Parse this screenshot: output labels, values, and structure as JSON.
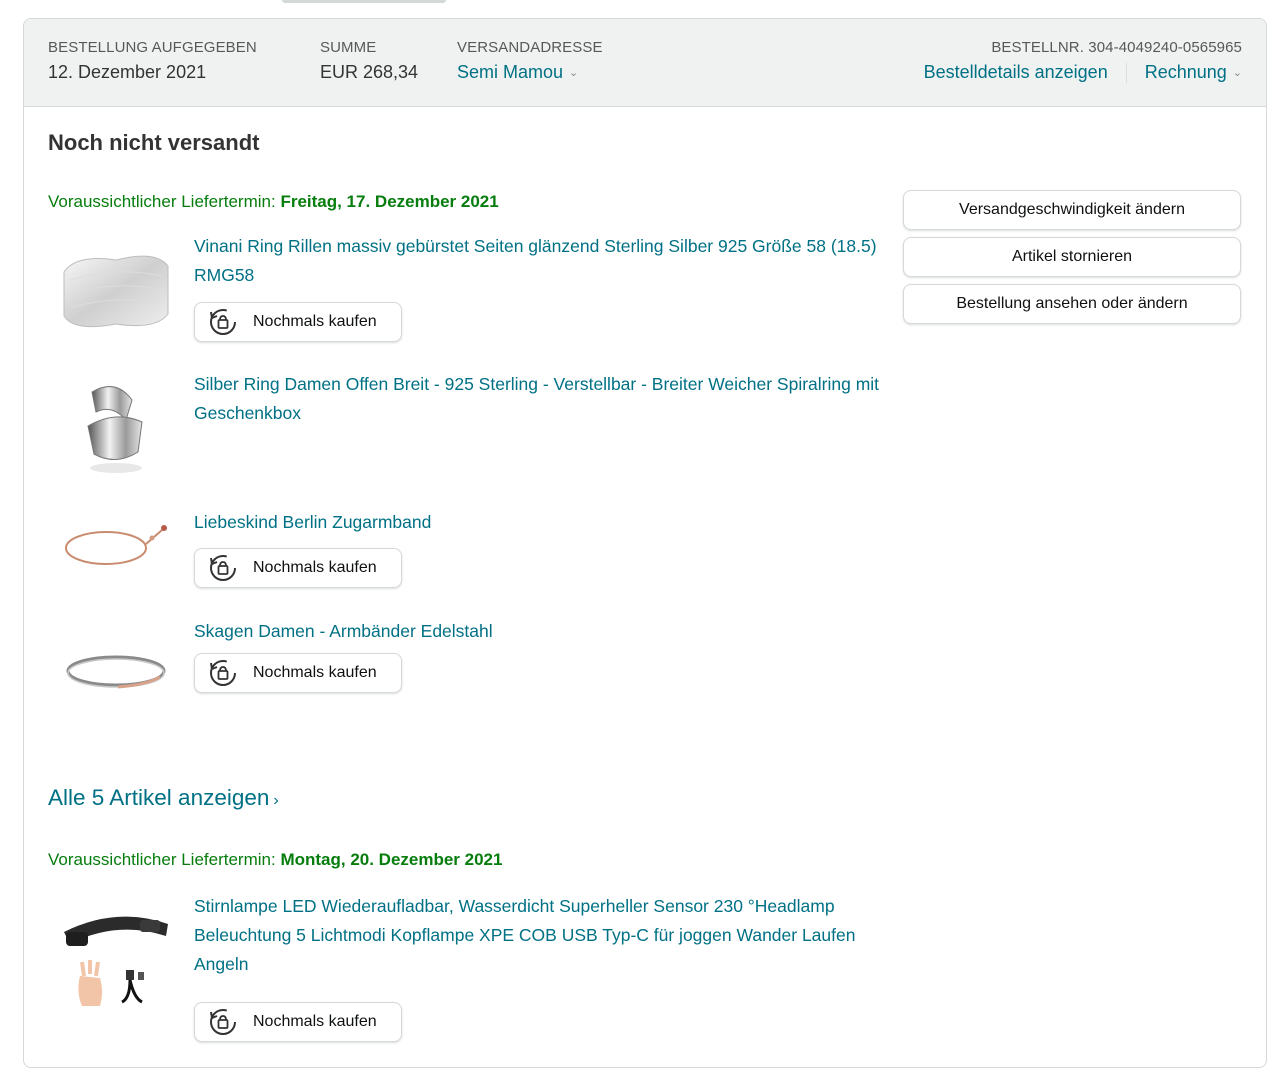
{
  "header": {
    "placed_label": "BESTELLUNG AUFGEGEBEN",
    "placed_value": "12. Dezember 2021",
    "total_label": "SUMME",
    "total_value": "EUR 268,34",
    "address_label": "VERSANDADRESSE",
    "address_value": "Semi Mamou",
    "order_number": "BESTELLNR. 304-4049240-0565965",
    "details_link": "Bestelldetails anzeigen",
    "invoice_link": "Rechnung"
  },
  "status": {
    "title": "Noch nicht versandt"
  },
  "shipments": [
    {
      "delivery_prefix": "Voraussichtlicher Liefertermin: ",
      "delivery_date": "Freitag, 17. Dezember 2021"
    },
    {
      "delivery_prefix": "Voraussichtlicher Liefertermin: ",
      "delivery_date": "Montag, 20. Dezember 2021"
    }
  ],
  "items": [
    {
      "title": "Vinani Ring Rillen massiv gebürstet Seiten glänzend Sterling Silber 925 Größe 58 (18.5) RMG58",
      "buy_again": "Nochmals kaufen",
      "icon": "brushed-silver-ring-image"
    },
    {
      "title": "Silber Ring Damen Offen Breit - 925 Sterling - Verstellbar - Breiter Weicher Spiralring mit Geschenkbox",
      "icon": "spiral-silver-ring-image"
    },
    {
      "title": "Liebeskind Berlin Zugarmband",
      "buy_again": "Nochmals kaufen",
      "icon": "rose-gold-bracelet-image"
    },
    {
      "title": "Skagen Damen - Armbänder Edelstahl",
      "buy_again": "Nochmals kaufen",
      "icon": "steel-bangle-image"
    },
    {
      "title": "Stirnlampe LED Wiederaufladbar, Wasserdicht Superheller Sensor 230 °Headlamp Beleuchtung 5 Lichtmodi Kopflampe XPE COB USB Typ-C für joggen Wander Laufen Angeln",
      "buy_again": "Nochmals kaufen",
      "icon": "headlamp-image"
    }
  ],
  "actions": {
    "change_speed": "Versandgeschwindigkeit ändern",
    "cancel_items": "Artikel stornieren",
    "view_edit": "Bestellung ansehen oder ändern"
  },
  "all_items_link": "Alle 5 Artikel anzeigen",
  "colors": {
    "link": "#007185",
    "delivery_green": "#067d0d",
    "header_bg": "#f0f2f2",
    "border": "#d5d9d9"
  }
}
